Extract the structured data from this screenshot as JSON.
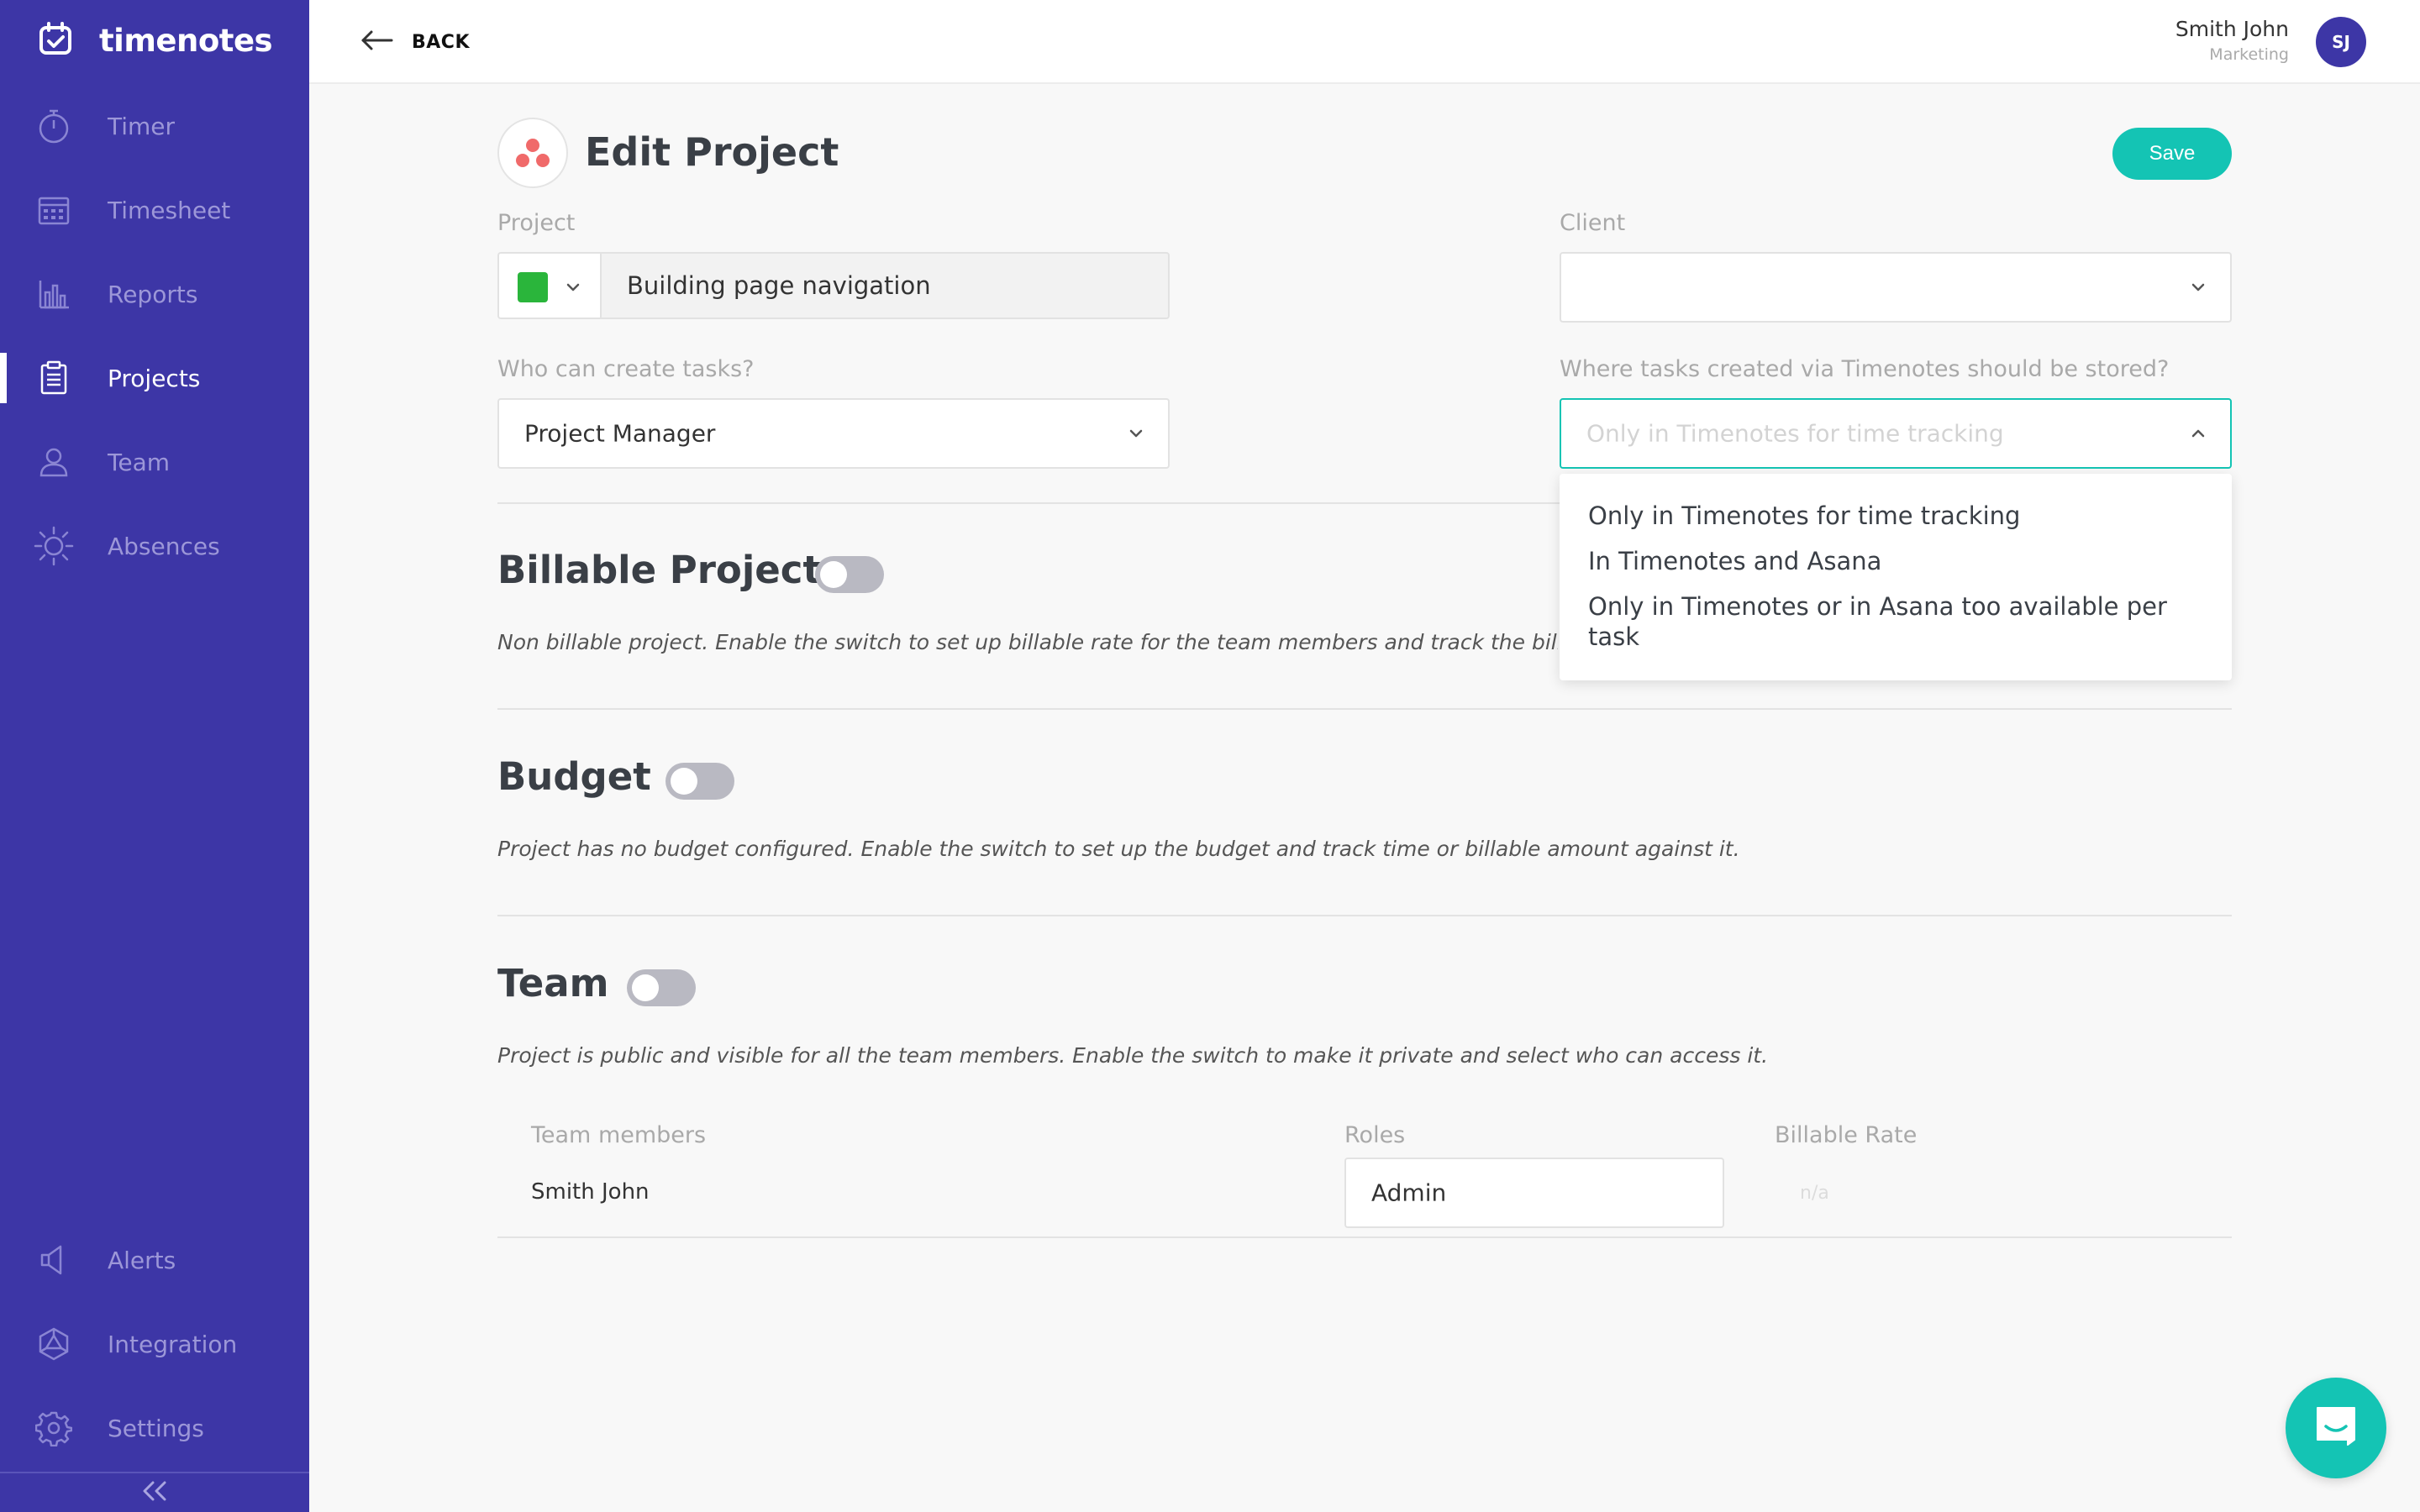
{
  "app": {
    "brand": "timenotes"
  },
  "sidebar": {
    "items": [
      {
        "label": "Timer",
        "icon": "stopwatch-icon"
      },
      {
        "label": "Timesheet",
        "icon": "calendar-grid-icon"
      },
      {
        "label": "Reports",
        "icon": "bar-chart-icon"
      },
      {
        "label": "Projects",
        "icon": "clipboard-icon",
        "active": true
      },
      {
        "label": "Team",
        "icon": "user-icon"
      },
      {
        "label": "Absences",
        "icon": "sun-icon"
      }
    ],
    "bottom_items": [
      {
        "label": "Alerts",
        "icon": "megaphone-icon"
      },
      {
        "label": "Integration",
        "icon": "integration-icon"
      },
      {
        "label": "Settings",
        "icon": "gear-icon"
      }
    ]
  },
  "header": {
    "back_label": "BACK",
    "user_name": "Smith John",
    "user_role": "Marketing",
    "avatar_initials": "SJ"
  },
  "page": {
    "title": "Edit Project",
    "save_label": "Save"
  },
  "form": {
    "project_label": "Project",
    "project_color": "#2ab53b",
    "project_name": "Building page navigation",
    "client_label": "Client",
    "client_value": "",
    "who_label": "Who can create tasks?",
    "who_value": "Project Manager",
    "where_label": "Where tasks created via Timenotes should be stored?",
    "where_placeholder": "Only in Timenotes for time tracking",
    "where_options": [
      "Only in Timenotes for time tracking",
      "In Timenotes and Asana",
      "Only in Timenotes or in Asana too available per task"
    ]
  },
  "sections": {
    "billable": {
      "title": "Billable Project",
      "description": "Non billable project. Enable the switch to set up billable rate for the team members and track the billable"
    },
    "budget": {
      "title": "Budget",
      "description": "Project has no budget configured. Enable the switch to set up the budget and track time or billable amount against it."
    },
    "team": {
      "title": "Team",
      "description": "Project is public and visible for all the team members. Enable the switch to make it private and select who can access it."
    }
  },
  "team_table": {
    "headers": [
      "Team members",
      "Roles",
      "Billable Rate"
    ],
    "rows": [
      {
        "member": "Smith John",
        "role": "Admin",
        "rate": "n/a"
      }
    ]
  },
  "colors": {
    "sidebar_bg": "#3d36a6",
    "accent": "#14c4b4",
    "toggle_off": "#b9b9c2"
  }
}
